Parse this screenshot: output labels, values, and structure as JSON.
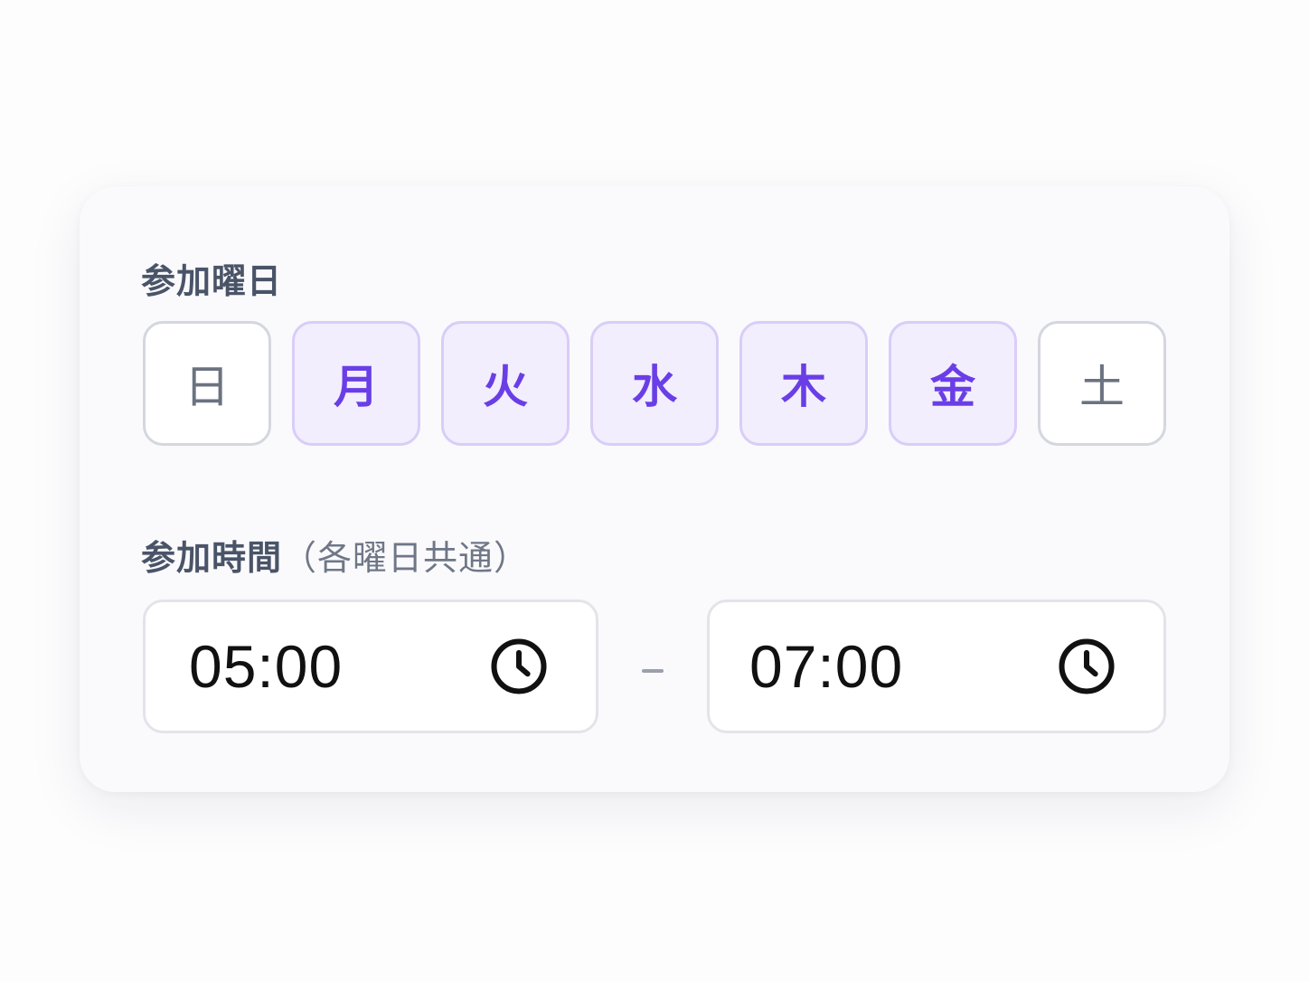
{
  "days_section": {
    "label": "参加曜日",
    "days": [
      {
        "label": "日",
        "selected": false
      },
      {
        "label": "月",
        "selected": true
      },
      {
        "label": "火",
        "selected": true
      },
      {
        "label": "水",
        "selected": true
      },
      {
        "label": "木",
        "selected": true
      },
      {
        "label": "金",
        "selected": true
      },
      {
        "label": "土",
        "selected": false
      }
    ]
  },
  "time_section": {
    "label": "参加時間",
    "note": "（各曜日共通）",
    "start_time": "05:00",
    "end_time": "07:00",
    "separator_icon": "dash",
    "clock_icon": "clock-icon"
  },
  "colors": {
    "accent": "#6a3ee6",
    "selected_bg": "#f2eefe",
    "selected_border": "#d9cdf8",
    "label": "#4a5468"
  }
}
